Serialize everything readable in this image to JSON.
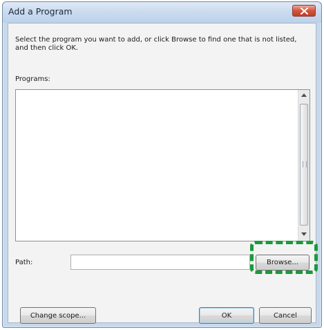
{
  "window": {
    "title": "Add a Program"
  },
  "dialog": {
    "instruction": "Select the program you want to add, or click Browse to find one that is not listed, and then click OK.",
    "programs_label": "Programs:",
    "programs_items": [],
    "path_label": "Path:",
    "path_value": ""
  },
  "buttons": {
    "browse": "Browse...",
    "change_scope": "Change scope...",
    "ok": "OK",
    "cancel": "Cancel"
  },
  "colors": {
    "highlight": "#1a9a3a",
    "titlebar": "#c9dbee",
    "close_button": "#d2563d"
  },
  "icons": {
    "close": "close-icon",
    "scroll_up": "chevron-up-icon",
    "scroll_down": "chevron-down-icon"
  }
}
